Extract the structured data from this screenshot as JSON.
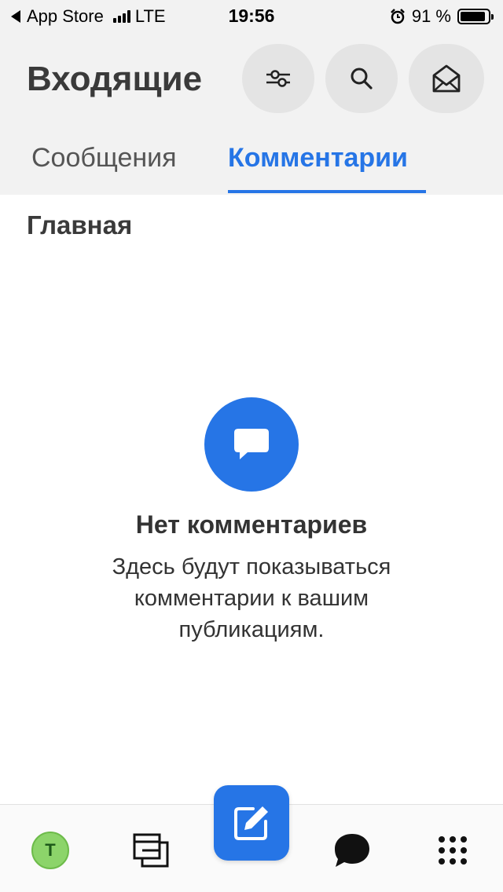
{
  "status_bar": {
    "back_app": "App Store",
    "network": "LTE",
    "time": "19:56",
    "battery_percent_label": "91 %",
    "battery_level": 0.91
  },
  "header": {
    "title": "Входящие",
    "buttons": [
      {
        "icon": "filter-sliders-icon"
      },
      {
        "icon": "search-icon"
      },
      {
        "icon": "open-envelope-icon"
      }
    ]
  },
  "tabs": {
    "items": [
      {
        "label": "Сообщения",
        "active": false
      },
      {
        "label": "Комментарии",
        "active": true
      }
    ]
  },
  "content": {
    "section_title": "Главная",
    "empty_state": {
      "icon": "comment-bubble-icon",
      "title": "Нет комментариев",
      "description": "Здесь будут показываться комментарии к вашим публикациям."
    }
  },
  "bottom_nav": {
    "avatar_letter": "T",
    "items": [
      {
        "icon": "avatar"
      },
      {
        "icon": "pages-icon"
      },
      {
        "icon": "compose-icon"
      },
      {
        "icon": "chat-bubble-icon"
      },
      {
        "icon": "grid-menu-icon"
      }
    ]
  },
  "colors": {
    "accent": "#2675e6",
    "header_bg": "#f2f2f2",
    "button_bg": "#e4e4e4",
    "avatar_bg": "#8cd46a"
  }
}
